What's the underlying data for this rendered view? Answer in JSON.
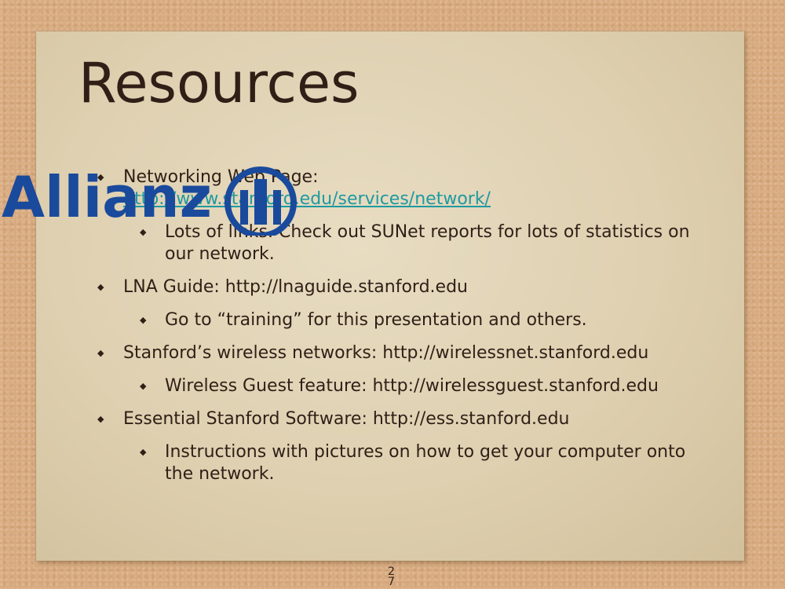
{
  "slide": {
    "title": "Resources",
    "page_number": "27"
  },
  "logo": {
    "text": "Allianz",
    "color": "#1a4a9c"
  },
  "items": [
    {
      "level": 1,
      "label": "Networking Web Page:",
      "link": "http://www.stanford.edu/services/network/"
    },
    {
      "level": 2,
      "text": "Lots of links. Check out SUNet reports for lots of statistics on our network."
    },
    {
      "level": 1,
      "text": "LNA Guide: http://lnaguide.stanford.edu"
    },
    {
      "level": 2,
      "text": "Go to “training” for this presentation and others."
    },
    {
      "level": 1,
      "text": "Stanford’s wireless networks: http://wirelessnet.stanford.edu"
    },
    {
      "level": 2,
      "text": "Wireless Guest feature: http://wirelessguest.stanford.edu"
    },
    {
      "level": 1,
      "text": "Essential Stanford Software: http://ess.stanford.edu"
    },
    {
      "level": 2,
      "text": "Instructions with pictures on how to get your computer onto the network."
    }
  ],
  "colors": {
    "text": "#2f1f17",
    "link": "#1e9aa1",
    "card": "#e3d6bb",
    "background": "#d8aa7e"
  },
  "icons": {
    "bullet": "diamond-bullet-icon"
  }
}
